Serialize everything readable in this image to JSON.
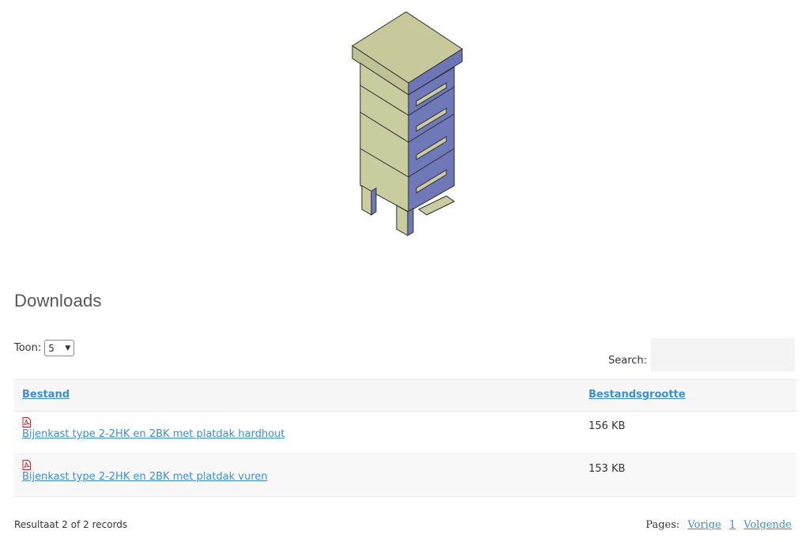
{
  "illustration": {
    "name": "beehive-drawing"
  },
  "downloads": {
    "heading": "Downloads",
    "toon_label": "Toon:",
    "page_size": "5",
    "search_label": "Search:",
    "search_value": "",
    "columns": {
      "file": "Bestand",
      "size": "Bestandsgrootte"
    },
    "rows": [
      {
        "icon": "pdf-icon",
        "name": "Bijenkast type 2-2HK en 2BK met platdak hardhout",
        "size": "156 KB"
      },
      {
        "icon": "pdf-icon",
        "name": "Bijenkast type 2-2HK en 2BK met platdak vuren",
        "size": "153 KB"
      }
    ],
    "result_text": "Resultaat 2 of 2 records",
    "pager": {
      "label": "Pages:",
      "prev": "Vorige",
      "page": "1",
      "next": "Volgende"
    }
  },
  "colors": {
    "link": "#3a8fd8",
    "hive_body": "#c9cc9e",
    "hive_front": "#6f78b8"
  }
}
